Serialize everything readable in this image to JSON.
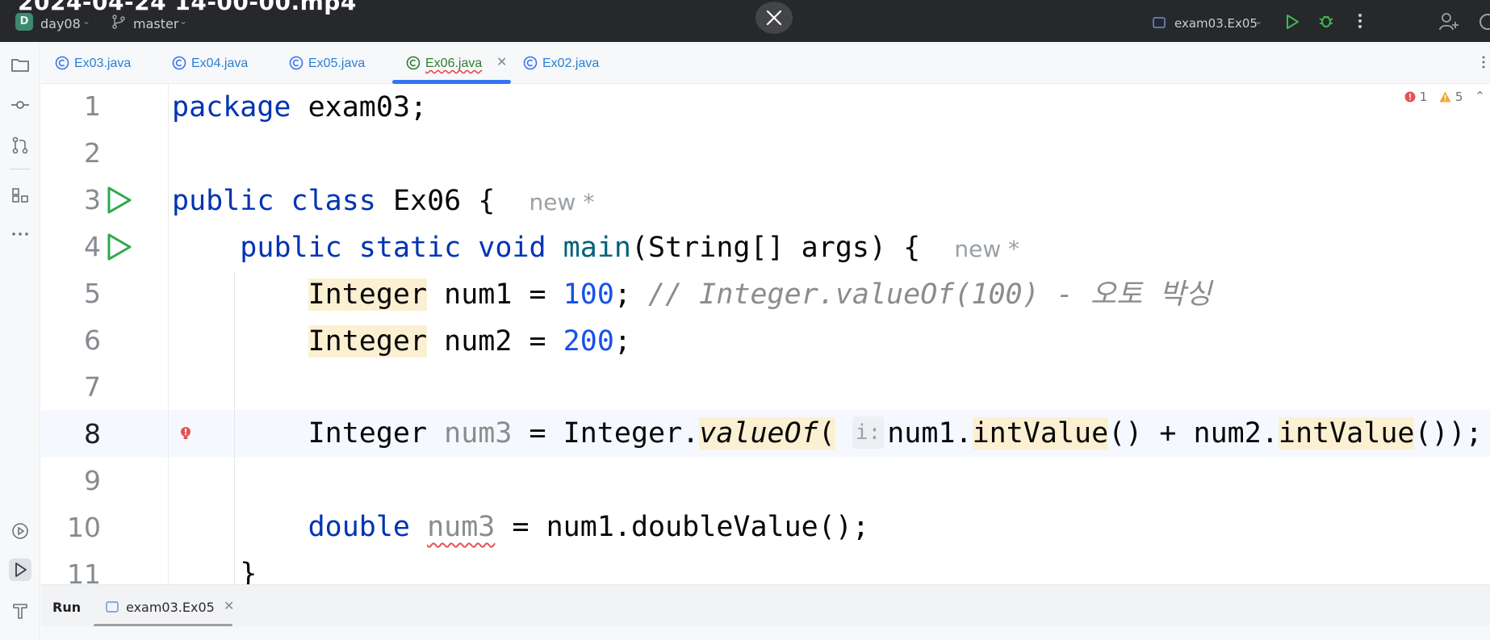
{
  "window": {
    "video_title": "2024-04-24 14-00-00.mp4",
    "project_badge": "D",
    "project_name": "day08",
    "branch": "master",
    "run_config": "exam03.Ex05"
  },
  "tabs": [
    {
      "label": "Ex03.java",
      "active": false
    },
    {
      "label": "Ex04.java",
      "active": false
    },
    {
      "label": "Ex05.java",
      "active": false
    },
    {
      "label": "Ex06.java",
      "active": true
    },
    {
      "label": "Ex02.java",
      "active": false
    }
  ],
  "inspection": {
    "errors": "1",
    "warnings": "5"
  },
  "editor": {
    "line_numbers": [
      "1",
      "2",
      "3",
      "4",
      "5",
      "6",
      "7",
      "8",
      "9",
      "10",
      "11"
    ],
    "current_line": "8",
    "code": {
      "l1_kw": "package",
      "l1_rest": " exam03;",
      "l3_kw": "public class",
      "l3_rest": " Ex06 {",
      "l3_hint": "new *",
      "l4_kw": "public static void",
      "l4_fn": "main",
      "l4_rest": "(String[] args) {",
      "l4_hint": "new *",
      "l5_type": "Integer",
      "l5_mid": " num1 = ",
      "l5_num": "100",
      "l5_end": "; ",
      "l5_comment": "// Integer.valueOf(100) - 오토 박싱",
      "l6_type": "Integer",
      "l6_mid": " num2 = ",
      "l6_num": "200",
      "l6_end": ";",
      "l8_a": "Integer ",
      "l8_var": "num3",
      "l8_b": " = Integer.",
      "l8_method": "valueOf",
      "l8_paren": "(",
      "l8_inlay": "i:",
      "l8_c": "num1.",
      "l8_m1": "intValue",
      "l8_d": "() + num2.",
      "l8_m2": "intValue",
      "l8_e": "());",
      "l10_kw": "double",
      "l10_var": "num3",
      "l10_rest": " = num1.doubleValue();",
      "l11": "}"
    }
  },
  "run_panel": {
    "title": "Run",
    "tab_label": "exam03.Ex05"
  },
  "colors": {
    "titlebar": "#27282c",
    "keyword": "#0033b3",
    "number": "#1750eb",
    "function": "#00627a",
    "comment": "#8c8c8c",
    "active_tab_underline": "#3574f0",
    "error": "#e55252",
    "warning": "#f0a732",
    "run_icon": "#2fa84f"
  }
}
